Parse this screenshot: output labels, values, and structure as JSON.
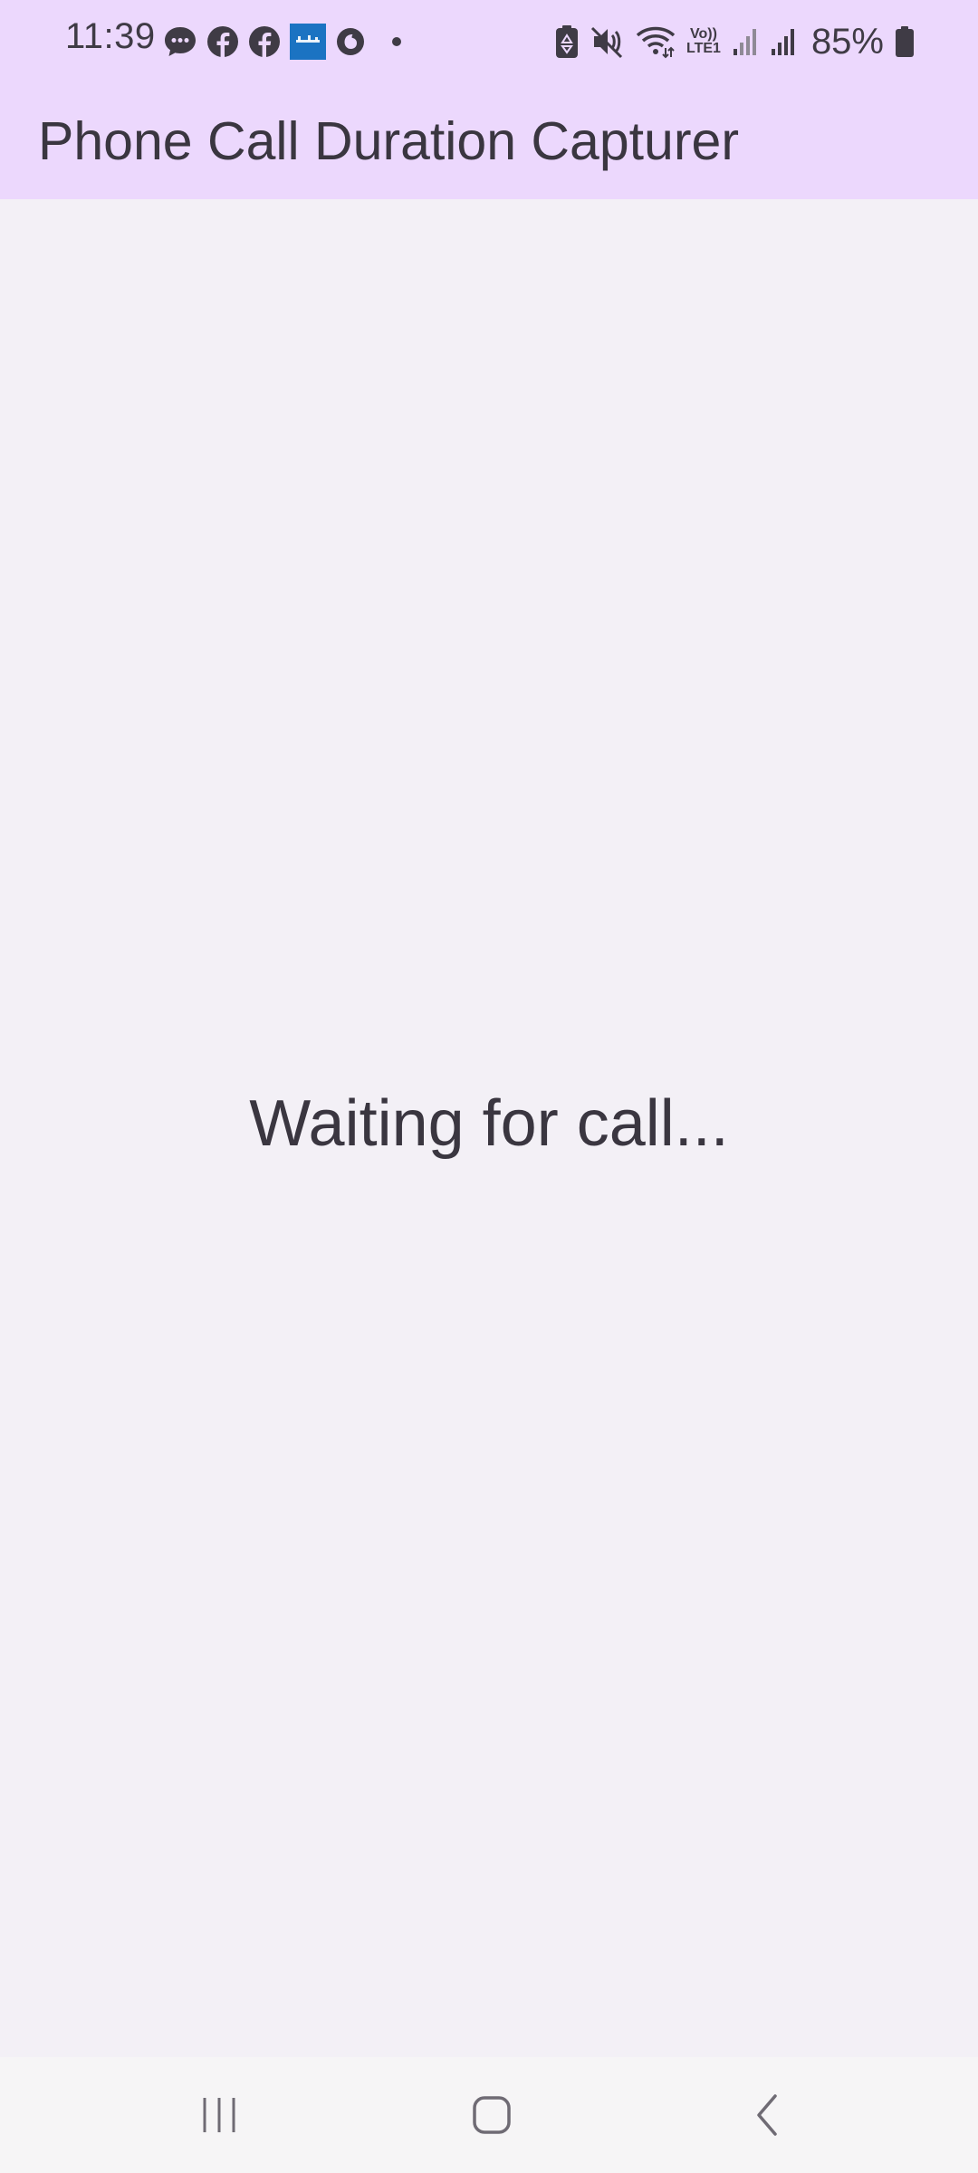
{
  "status_bar": {
    "time": "11:39",
    "battery_percent": "85%",
    "notification_icons": [
      "messages-icon",
      "facebook-icon",
      "facebook-icon",
      "arabic-app-icon",
      "vodafone-icon",
      "more-dot-icon"
    ],
    "system_icons": [
      "battery-saver-icon",
      "mute-icon",
      "wifi-icon",
      "volte-icon",
      "signal-icon",
      "signal-icon",
      "battery-icon"
    ],
    "volte_label_top": "Vo))",
    "volte_label_bottom": "LTE1"
  },
  "app_bar": {
    "title": "Phone Call Duration Capturer",
    "background": "#ecd8fd"
  },
  "main": {
    "status_message": "Waiting for call..."
  },
  "nav_bar": {
    "buttons": [
      "recent-apps",
      "home",
      "back"
    ]
  },
  "colors": {
    "app_bar_bg": "#ecd8fd",
    "content_bg": "#f3f0f6",
    "text": "#3a3640"
  }
}
